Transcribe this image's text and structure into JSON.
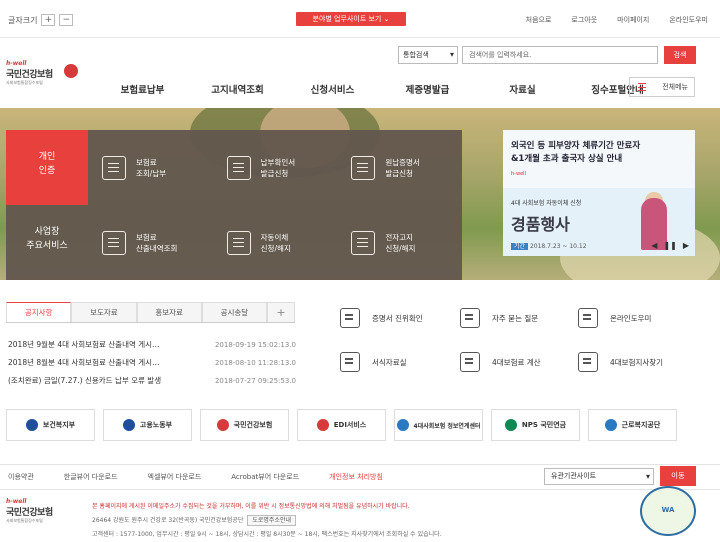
{
  "topbar": {
    "font_size_label": "글자크기",
    "font_plus": "+",
    "font_minus": "−",
    "biz_site_label": "분야별 업무사이트 보기",
    "links": [
      "처음으로",
      "로그아웃",
      "마이페이지",
      "온라인도우미"
    ]
  },
  "logo": {
    "tag": "h-well",
    "name": "국민건강보험",
    "sub": "사회보험통합징수포털"
  },
  "search": {
    "select_value": "통합검색",
    "placeholder": "검색어를 입력하세요.",
    "button": "검색"
  },
  "gnb": [
    "보험료납부",
    "고지내역조회",
    "신청서비스",
    "제증명발급",
    "자료실",
    "징수포털안내"
  ],
  "all_menu_label": "전체메뉴",
  "quick": {
    "categories": [
      {
        "label": "개인\n인증"
      },
      {
        "label": "사업장\n주요서비스"
      }
    ],
    "items": [
      {
        "line1": "보험료",
        "line2": "조회/납부",
        "icon": "cursor-click-icon"
      },
      {
        "line1": "납부확인서",
        "line2": "발급신청",
        "icon": "document-icon"
      },
      {
        "line1": "원납증명서",
        "line2": "발급신청",
        "icon": "certificate-icon"
      },
      {
        "line1": "보험료",
        "line2": "산출내역조회",
        "icon": "calculator-icon"
      },
      {
        "line1": "자동이체",
        "line2": "신청/해지",
        "icon": "money-bag-icon"
      },
      {
        "line1": "전자고지",
        "line2": "신청/해지",
        "icon": "e-notice-icon"
      }
    ]
  },
  "banner": {
    "b1_line1": "외국인 등 피부양자 체류기간 만료자",
    "b1_line2": "&1개월 초과 출국자 상실 안내",
    "b1_note": "h-well",
    "b2_line1": "4대 사회보험 자동이체 신청",
    "b2_title": "경품행사",
    "b2_period_label": "기간",
    "b2_period": "2018.7.23 ~ 10.12",
    "nav_prev": "◀",
    "nav_pause": "❚❚",
    "nav_next": "▶"
  },
  "notice": {
    "tabs": [
      "공지사항",
      "보도자료",
      "홍보자료",
      "공시송달",
      "+"
    ],
    "items": [
      {
        "title": "2018년 9월분 4대 사회보험료 산출내역 게시…",
        "date": "2018-09-19 15:02:13.0"
      },
      {
        "title": "2018년 8월분 4대 사회보험료 산출내역 게시…",
        "date": "2018-08-10 11:28:13.0"
      },
      {
        "title": "(조치완료) 금일(7.27.) 신용카드 납부 오류 발생",
        "date": "2018-07-27 09:25:53.0"
      }
    ]
  },
  "services": [
    {
      "label": "증명서 진위확인",
      "icon": "certificate-check-icon"
    },
    {
      "label": "자주 묻는 질문",
      "icon": "faq-icon"
    },
    {
      "label": "온라인도우미",
      "icon": "headset-icon"
    },
    {
      "label": "서식자료실",
      "icon": "form-edit-icon"
    },
    {
      "label": "4대보험료 계산",
      "icon": "calculator-icon"
    },
    {
      "label": "4대보험지사찾기",
      "icon": "location-icon"
    }
  ],
  "partners": [
    {
      "label": "보건복지부",
      "color": "#1f4e9c"
    },
    {
      "label": "고용노동부",
      "color": "#1f4e9c"
    },
    {
      "label": "국민건강보험",
      "color": "#d63a3a"
    },
    {
      "label": "EDI서비스",
      "color": "#d63a3a"
    },
    {
      "label": "4대사회보험 정보연계센터",
      "color": "#2a7ac1"
    },
    {
      "label": "NPS 국민연금",
      "color": "#0d8a52"
    },
    {
      "label": "근로복지공단",
      "color": "#2a7ac1"
    }
  ],
  "footer": {
    "links": [
      "이용약관",
      "한글뷰어 다운로드",
      "엑셀뷰어 다운로드",
      "Acrobat뷰어 다운로드",
      "개인정보 처리방침"
    ],
    "related_select": "유관기관사이트",
    "go_button": "이동",
    "warning": "본 홈페이지에 게시된 이메일주소가 수집되는 것을 거부하며, 이를 위반 시 정보통신망법에 의해 처벌됨을 유념하시기 바랍니다.",
    "address": "26464 강원도 원주시 건강로 32(반곡동) 국민건강보험공단",
    "map_button": "도로명주소안내",
    "contact": "고객센터 : 1577-1000, 업무시간 : 평일 9시 ~ 18시, 상담시간 : 평일 8시30분 ~ 18시, 팩스번호는 지사찾기에서 조회하실 수 있습니다.",
    "wa_mark": "WA"
  },
  "accent": "#e8403d"
}
